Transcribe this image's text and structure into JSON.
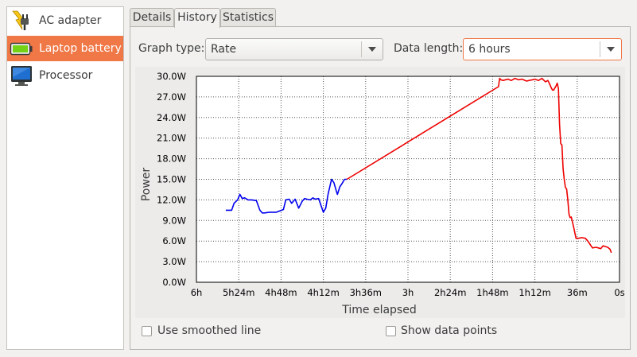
{
  "sidebar": {
    "items": [
      {
        "label": "AC adapter",
        "icon": "ac-adapter-icon",
        "selected": false
      },
      {
        "label": "Laptop battery",
        "icon": "battery-icon",
        "selected": true
      },
      {
        "label": "Processor",
        "icon": "processor-icon",
        "selected": false
      }
    ]
  },
  "tabs": [
    {
      "label": "Details",
      "active": false
    },
    {
      "label": "History",
      "active": true
    },
    {
      "label": "Statistics",
      "active": false
    }
  ],
  "controls": {
    "graph_type_label": "Graph type:",
    "graph_type_value": "Rate",
    "data_length_label": "Data length:",
    "data_length_value": "6 hours",
    "smoothed_label": "Use smoothed line",
    "smoothed_checked": false,
    "points_label": "Show data points",
    "points_checked": false
  },
  "colors": {
    "accent": "#f07746",
    "discharging": "#0000ee",
    "charging": "#ee0000"
  },
  "chart_data": {
    "type": "line",
    "xlabel": "Time elapsed",
    "ylabel": "Power",
    "x_ticks": [
      "6h",
      "5h24m",
      "4h48m",
      "4h12m",
      "3h36m",
      "3h",
      "2h24m",
      "1h48m",
      "1h12m",
      "36m",
      "0s"
    ],
    "y_ticks": [
      "30.0W",
      "27.0W",
      "24.0W",
      "21.0W",
      "18.0W",
      "15.0W",
      "12.0W",
      "9.0W",
      "6.0W",
      "3.0W",
      "0.0W"
    ],
    "xlim_minutes_elapsed": [
      360,
      0
    ],
    "ylim": [
      0,
      30
    ],
    "grid": true,
    "series": [
      {
        "color": "#0000ee",
        "x_minutes": [
          335,
          330,
          328,
          325,
          323,
          321,
          319,
          316,
          313,
          309,
          306,
          304,
          302,
          298,
          292,
          286,
          284,
          281,
          279,
          276,
          273,
          270,
          268,
          266,
          263,
          261,
          259,
          256,
          254,
          252,
          250,
          248,
          245,
          243,
          241,
          240,
          238,
          236,
          234,
          232
        ],
        "values": [
          10.5,
          10.5,
          11.5,
          12.0,
          12.8,
          12.2,
          12.3,
          12.0,
          12.0,
          11.9,
          10.5,
          10.1,
          10.1,
          10.2,
          10.2,
          10.6,
          12.0,
          12.1,
          11.5,
          12.1,
          10.8,
          11.8,
          12.2,
          12.1,
          12.0,
          12.3,
          12.1,
          12.2,
          11.2,
          10.2,
          10.8,
          12.8,
          15.0,
          14.5,
          13.3,
          12.8,
          13.9,
          14.4,
          15.0,
          15.0
        ]
      },
      {
        "color": "#ee0000",
        "x_minutes": [
          232,
          103,
          102,
          101,
          99,
          97,
          95,
          92,
          89,
          86,
          83,
          79,
          77,
          74,
          72,
          69,
          66,
          63,
          61,
          60,
          59,
          58,
          57,
          56,
          55,
          54,
          53,
          52,
          51,
          50,
          49,
          48,
          47,
          46,
          45,
          44,
          43,
          42,
          41,
          39,
          37,
          35,
          32,
          29,
          27,
          25,
          23,
          20,
          18,
          16,
          14,
          12,
          10,
          8,
          7
        ],
        "values": [
          15.0,
          28.5,
          29.7,
          29.5,
          29.4,
          29.5,
          29.6,
          29.4,
          29.7,
          29.5,
          29.6,
          29.3,
          29.4,
          29.5,
          29.6,
          29.4,
          29.7,
          29.2,
          29.4,
          29.1,
          28.7,
          28.3,
          28.0,
          28.0,
          28.3,
          28.6,
          29.0,
          28.2,
          23.0,
          20.2,
          20.0,
          16.5,
          15.0,
          13.8,
          13.6,
          12.0,
          9.9,
          9.4,
          9.5,
          8.0,
          6.4,
          6.4,
          6.5,
          6.4,
          6.0,
          5.5,
          5.0,
          5.1,
          5.0,
          4.9,
          5.3,
          5.2,
          5.1,
          4.8,
          4.3
        ]
      }
    ]
  }
}
